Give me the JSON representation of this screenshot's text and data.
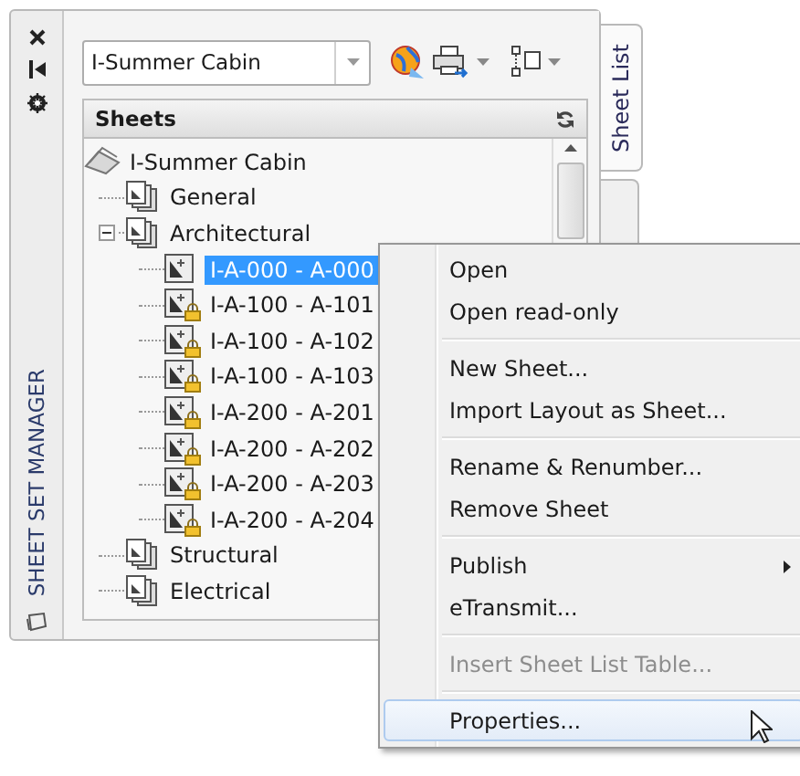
{
  "palette": {
    "title": "SHEET SET MANAGER",
    "side_tabs": [
      {
        "label": "Sheet List",
        "selected": true
      },
      {
        "selected": false
      }
    ]
  },
  "sheet_set_dropdown": {
    "value": "I-Summer Cabin"
  },
  "sheets_header": {
    "title": "Sheets"
  },
  "tree": [
    {
      "kind": "set",
      "label": "I-Summer Cabin",
      "selected": false,
      "children": [
        {
          "kind": "subset",
          "label": "General",
          "selected": false
        },
        {
          "kind": "subset",
          "label": "Architectural",
          "selected": false,
          "expanded": true,
          "children": [
            {
              "kind": "sheet",
              "label": "I-A-000 - A-000",
              "selected": true,
              "locked": false
            },
            {
              "kind": "sheet",
              "label": "I-A-100 - A-101",
              "selected": false,
              "locked": true
            },
            {
              "kind": "sheet",
              "label": "I-A-100 - A-102",
              "selected": false,
              "locked": true
            },
            {
              "kind": "sheet",
              "label": "I-A-100 - A-103",
              "selected": false,
              "locked": true
            },
            {
              "kind": "sheet",
              "label": "I-A-200 - A-201",
              "selected": false,
              "locked": true
            },
            {
              "kind": "sheet",
              "label": "I-A-200 - A-202",
              "selected": false,
              "locked": true
            },
            {
              "kind": "sheet",
              "label": "I-A-200 - A-203",
              "selected": false,
              "locked": true
            },
            {
              "kind": "sheet",
              "label": "I-A-200 - A-204",
              "selected": false,
              "locked": true
            }
          ]
        },
        {
          "kind": "subset",
          "label": "Structural",
          "selected": false
        },
        {
          "kind": "subset",
          "label": "Electrical",
          "selected": false
        }
      ]
    }
  ],
  "context_menu": {
    "groups": [
      [
        {
          "label": "Open",
          "disabled": false,
          "hovered": false,
          "submenu": false
        },
        {
          "label": "Open read-only",
          "disabled": false,
          "hovered": false,
          "submenu": false
        }
      ],
      [
        {
          "label": "New Sheet...",
          "disabled": false,
          "hovered": false,
          "submenu": false
        },
        {
          "label": "Import Layout as Sheet...",
          "disabled": false,
          "hovered": false,
          "submenu": false
        }
      ],
      [
        {
          "label": "Rename & Renumber...",
          "disabled": false,
          "hovered": false,
          "submenu": false
        },
        {
          "label": "Remove Sheet",
          "disabled": false,
          "hovered": false,
          "submenu": false
        }
      ],
      [
        {
          "label": "Publish",
          "disabled": false,
          "hovered": false,
          "submenu": true
        },
        {
          "label": "eTransmit...",
          "disabled": false,
          "hovered": false,
          "submenu": false
        }
      ],
      [
        {
          "label": "Insert Sheet List Table...",
          "disabled": true,
          "hovered": false,
          "submenu": false
        }
      ],
      [
        {
          "label": "Properties...",
          "disabled": false,
          "hovered": true,
          "submenu": false
        }
      ]
    ]
  }
}
